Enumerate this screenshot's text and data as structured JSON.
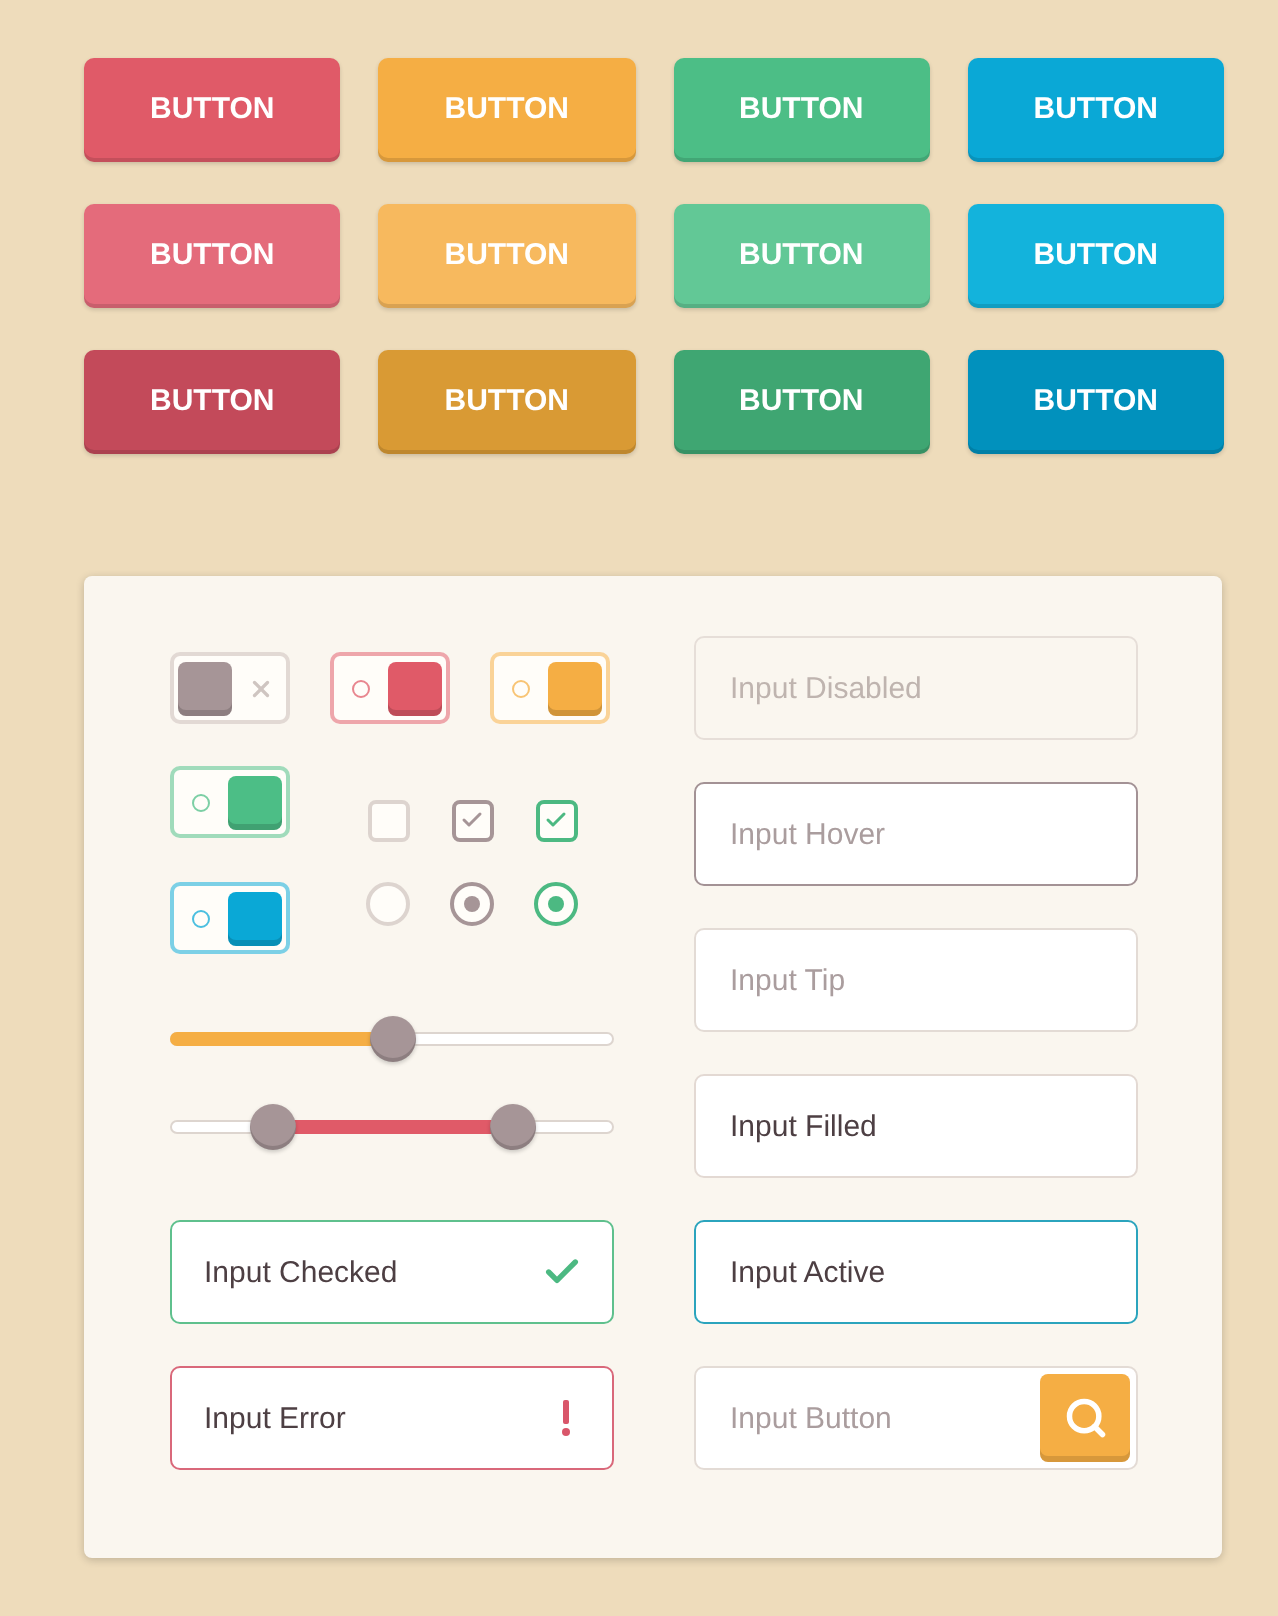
{
  "button_grid": {
    "rows": [
      [
        {
          "label": "BUTTON",
          "color": "#e05a68"
        },
        {
          "label": "BUTTON",
          "color": "#f5ae44"
        },
        {
          "label": "BUTTON",
          "color": "#4cbe86"
        },
        {
          "label": "BUTTON",
          "color": "#0aa8d6"
        }
      ],
      [
        {
          "label": "BUTTON",
          "color": "#e46b7b"
        },
        {
          "label": "BUTTON",
          "color": "#f7b95e"
        },
        {
          "label": "BUTTON",
          "color": "#62c896"
        },
        {
          "label": "BUTTON",
          "color": "#13b3dc"
        }
      ],
      [
        {
          "label": "BUTTON",
          "color": "#c34a5a"
        },
        {
          "label": "BUTTON",
          "color": "#d99a34"
        },
        {
          "label": "BUTTON",
          "color": "#3fa672"
        },
        {
          "label": "BUTTON",
          "color": "#0191bd"
        }
      ]
    ]
  },
  "left_column": {
    "toggles": [
      {
        "on": false,
        "color": "#a69597"
      },
      {
        "on": true,
        "color": "#e05a68"
      },
      {
        "on": true,
        "color": "#f5ae44"
      },
      {
        "on": true,
        "color": "#4cbe86"
      },
      {
        "on": true,
        "color": "#0aa8d6"
      }
    ],
    "checkboxes": [
      {
        "checked": false,
        "color": "#ddd4cf"
      },
      {
        "checked": true,
        "color": "#a69597"
      },
      {
        "checked": true,
        "color": "#4cb982"
      }
    ],
    "radios": [
      {
        "selected": false,
        "color": "#ddd4cf"
      },
      {
        "selected": true,
        "color": "#a69597"
      },
      {
        "selected": true,
        "color": "#4cb982"
      }
    ],
    "sliders": [
      {
        "kind": "single",
        "color": "#f5ae44",
        "level": 0.5
      },
      {
        "kind": "range",
        "color": "#e05a68",
        "handles": [
          {
            "level": 0.23
          },
          {
            "level": 0.77
          }
        ]
      }
    ],
    "inputs": [
      {
        "kind": "checked",
        "value": "Input Checked"
      },
      {
        "kind": "error",
        "value": "Input Error"
      }
    ]
  },
  "right_column": {
    "inputs": [
      {
        "kind": "disabled",
        "placeholder": "Input Disabled"
      },
      {
        "kind": "hover",
        "placeholder": "Input Hover"
      },
      {
        "kind": "tip",
        "placeholder": "Input Tip"
      },
      {
        "kind": "filled",
        "value": "Input Filled"
      },
      {
        "kind": "active",
        "value": "Input Active"
      },
      {
        "kind": "button",
        "placeholder": "Input Button"
      }
    ]
  }
}
